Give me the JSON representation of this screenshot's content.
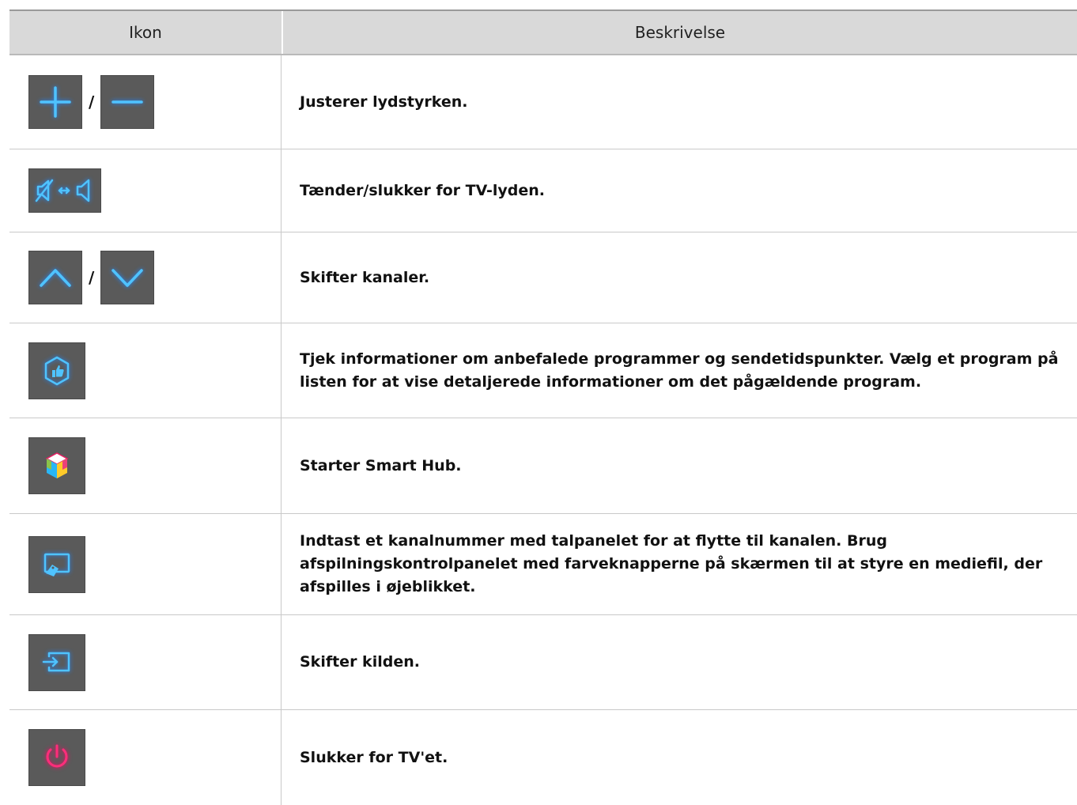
{
  "table": {
    "headers": {
      "icon": "Ikon",
      "description": "Beskrivelse"
    },
    "separator": "/",
    "rows": [
      {
        "icons": [
          "plus-icon",
          "minus-icon"
        ],
        "description": "Justerer lydstyrken."
      },
      {
        "icons": [
          "mute-toggle-icon"
        ],
        "description": "Tænder/slukker for TV-lyden."
      },
      {
        "icons": [
          "chevron-up-icon",
          "chevron-down-icon"
        ],
        "description": "Skifter kanaler."
      },
      {
        "icons": [
          "recommended-icon"
        ],
        "description": "Tjek informationer om anbefalede programmer og sendetidspunkter. Vælg et program på listen for at vise detaljerede informationer om det pågældende program."
      },
      {
        "icons": [
          "smart-hub-icon"
        ],
        "description": "Starter Smart Hub."
      },
      {
        "icons": [
          "keypad-icon"
        ],
        "description": "Indtast et kanalnummer med talpanelet for at flytte til kanalen. Brug afspilningskontrolpanelet med farveknapperne på skærmen til at styre en mediefil, der afspilles i øjeblikket."
      },
      {
        "icons": [
          "source-icon"
        ],
        "description": "Skifter kilden."
      },
      {
        "icons": [
          "power-icon"
        ],
        "description": "Slukker for TV'et."
      }
    ]
  },
  "colors": {
    "icon_glow": "#4fc3ff",
    "power_glow": "#ff2d7a",
    "header_bg": "#d9d9d9",
    "button_bg": "#5a5a5a"
  }
}
